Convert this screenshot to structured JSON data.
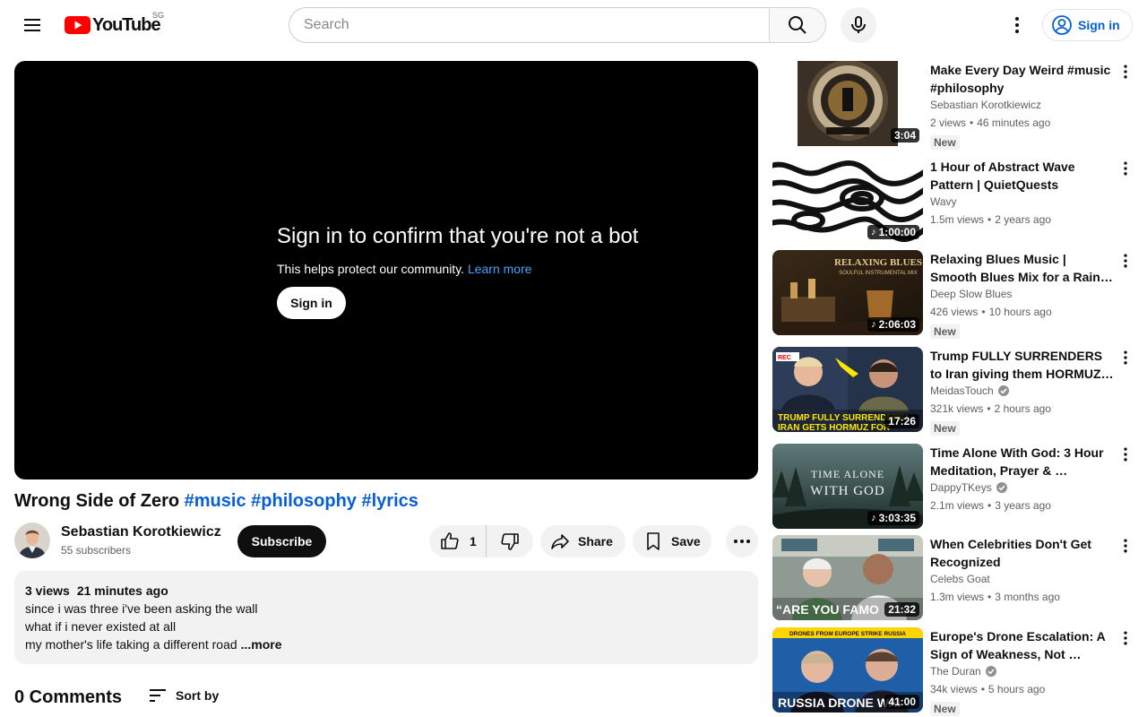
{
  "header": {
    "logo_text": "YouTube",
    "region": "SG",
    "search_placeholder": "Search",
    "signin_label": "Sign in"
  },
  "player": {
    "title": "Sign in to confirm that you're not a bot",
    "subtitle": "This helps protect our community.",
    "learn_more": "Learn more",
    "signin_label": "Sign in"
  },
  "video": {
    "title": "Wrong Side of Zero",
    "hashtags": [
      "#music",
      "#philosophy",
      "#lyrics"
    ],
    "channel": "Sebastian Korotkiewicz",
    "subscribers": "55 subscribers",
    "subscribe_label": "Subscribe",
    "likes": "1",
    "share_label": "Share",
    "save_label": "Save",
    "views": "3 views",
    "uploaded": "21 minutes ago",
    "description_lines": [
      "since i was three i've been asking the wall",
      "what if i never existed at all",
      "my mother's life taking a different road"
    ],
    "description_fade": " ",
    "more_label": "...more"
  },
  "comments": {
    "count_label": "0 Comments",
    "sort_label": "Sort by"
  },
  "recommendations": [
    {
      "title": "Make Every Day Weird #music #philosophy",
      "channel": "Sebastian Korotkiewicz",
      "verified": false,
      "views": "2 views",
      "age": "46 minutes ago",
      "duration": "3:04",
      "music": false,
      "badge": "New",
      "thumb": "laundromat"
    },
    {
      "title": "1 Hour of Abstract Wave Pattern | QuietQuests",
      "channel": "Wavy",
      "verified": false,
      "views": "1.5m views",
      "age": "2 years ago",
      "duration": "1:00:00",
      "music": true,
      "badge": "",
      "thumb": "waves"
    },
    {
      "title": "Relaxing Blues Music | Smooth Blues Mix for a Rainy Evening…",
      "channel": "Deep Slow Blues",
      "verified": false,
      "views": "426 views",
      "age": "10 hours ago",
      "duration": "2:06:03",
      "music": true,
      "badge": "New",
      "thumb": "blues",
      "thumb_text": [
        "RELAXING BLUES",
        "SOULFUL INSTRUMENTAL MIX"
      ]
    },
    {
      "title": "Trump FULLY SURRENDERS to Iran giving them HORMUZ …",
      "channel": "MeidasTouch",
      "verified": true,
      "views": "321k views",
      "age": "2 hours ago",
      "duration": "17:26",
      "music": false,
      "badge": "New",
      "thumb": "trump",
      "thumb_text": [
        "TRUMP FULLY SURRENDERS!",
        "IRAN GETS HORMUZ FOR"
      ]
    },
    {
      "title": "Time Alone With God: 3 Hour Meditation, Prayer & …",
      "channel": "DappyTKeys",
      "verified": true,
      "views": "2.1m views",
      "age": "3 years ago",
      "duration": "3:03:35",
      "music": true,
      "badge": "",
      "thumb": "forest",
      "thumb_text": [
        "TIME ALONE",
        "WITH GOD"
      ]
    },
    {
      "title": "When Celebrities Don't Get Recognized",
      "channel": "Celebs Goat",
      "verified": false,
      "views": "1.3m views",
      "age": "3 months ago",
      "duration": "21:32",
      "music": false,
      "badge": "",
      "thumb": "subway",
      "thumb_text": [
        "“ARE YOU FAMO"
      ]
    },
    {
      "title": "Europe's Drone Escalation: A Sign of Weakness, Not …",
      "channel": "The Duran",
      "verified": true,
      "views": "34k views",
      "age": "5 hours ago",
      "duration": "41:00",
      "music": false,
      "badge": "New",
      "thumb": "duran",
      "thumb_text": [
        "DRONES FROM EUROPE STRIKE RUSSIA",
        "RUSSIA DRONE WAI"
      ]
    }
  ]
}
